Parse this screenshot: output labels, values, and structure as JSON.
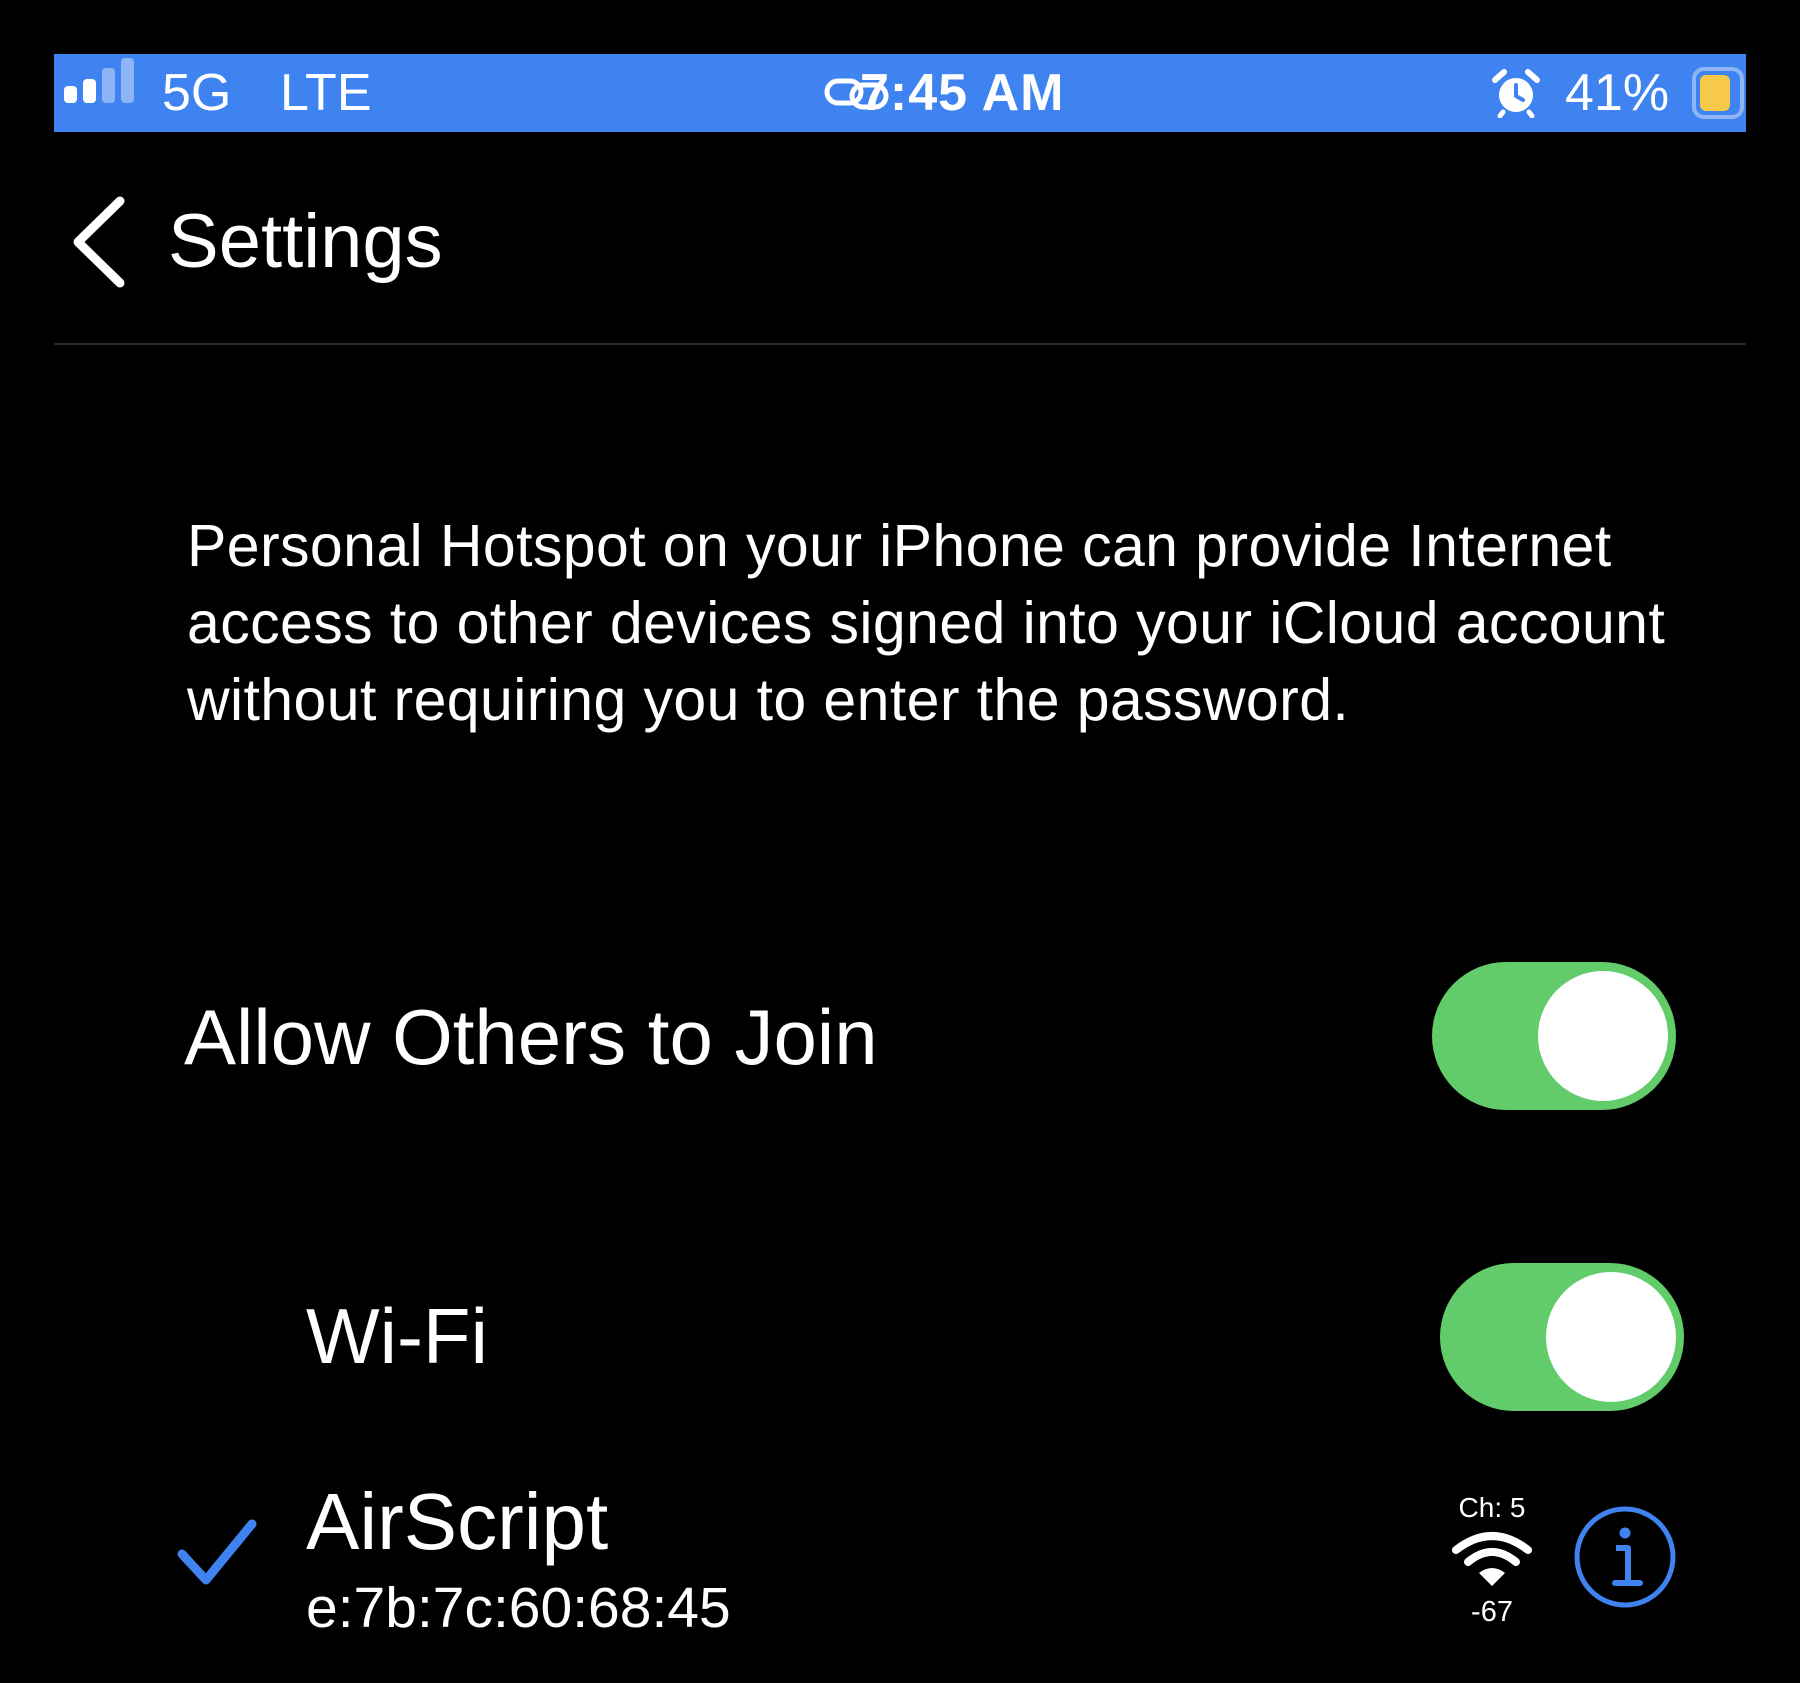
{
  "status_bar": {
    "network_label": "5G",
    "carrier_type": "LTE",
    "time": "7:45 AM",
    "battery_percent_text": "41%",
    "battery_level": 0.41,
    "signal_bars_active": 2,
    "signal_bars_total": 4,
    "background_color": "#3f83f0",
    "battery_fill_color": "#f7c948",
    "icons": {
      "signal": "cellular-signal-icon",
      "hotspot": "hotspot-link-icon",
      "alarm": "alarm-clock-icon",
      "battery": "battery-icon"
    }
  },
  "nav": {
    "back_label": "Settings",
    "back_icon": "chevron-left-icon"
  },
  "description": {
    "text": "Personal Hotspot on your iPhone can provide Internet access to other devices signed into your iCloud account without requiring you to enter the password."
  },
  "rows": {
    "allow_others": {
      "label": "Allow Others to Join",
      "enabled": true
    },
    "wifi": {
      "label": "Wi-Fi",
      "enabled": true
    }
  },
  "network": {
    "name": "AirScript",
    "mac": "e:7b:7c:60:68:45",
    "channel": "Ch: 5",
    "rssi": "-67",
    "selected": true,
    "checkmark_icon": "checkmark-icon",
    "signal_icon": "wifi-signal-icon",
    "info_icon": "info-icon"
  },
  "colors": {
    "toggle_on": "#62cb6a",
    "accent_blue": "#3f83f0",
    "background": "#000000",
    "text": "#ffffff"
  }
}
